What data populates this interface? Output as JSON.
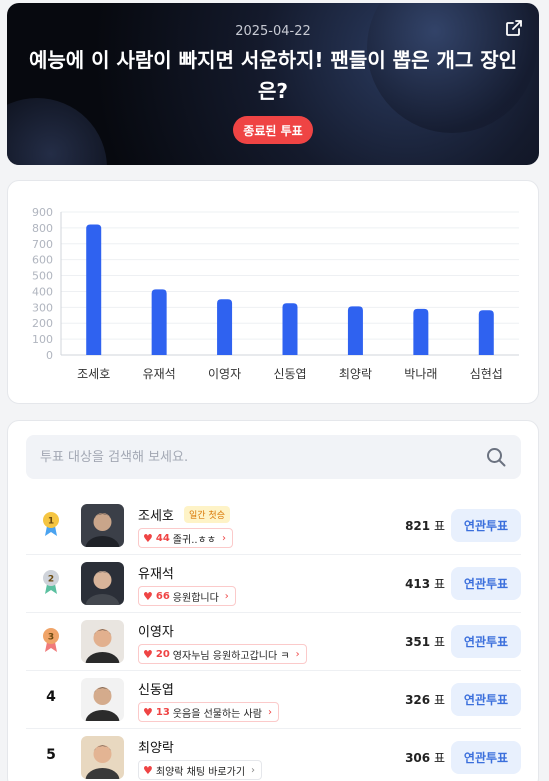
{
  "header": {
    "date": "2025-04-22",
    "title": "예능에 이 사람이 빠지면 서운하지! 팬들이 뽑은 개그 장인은?",
    "status_badge": "종료된 투표",
    "share_icon": "share-icon"
  },
  "chart_data": {
    "type": "bar",
    "categories": [
      "조세호",
      "유재석",
      "이영자",
      "신동엽",
      "최양락",
      "박나래",
      "심현섭"
    ],
    "values": [
      821,
      413,
      351,
      326,
      306,
      290,
      282
    ],
    "ylim": [
      0,
      900
    ],
    "yticks": [
      0,
      100,
      200,
      300,
      400,
      500,
      600,
      700,
      800,
      900
    ],
    "bar_color": "#2f62f0",
    "grid": true
  },
  "search": {
    "placeholder": "투표 대상을 검색해 보세요.",
    "icon": "search-icon"
  },
  "candidates": [
    {
      "rank": "1",
      "medal": "gold",
      "name": "조세호",
      "tag": "일간 첫승",
      "cheer_count": "44",
      "cheer_text": "졸귀..ㅎㅎ",
      "votes": "821",
      "unit": "표",
      "button": "연관투표"
    },
    {
      "rank": "2",
      "medal": "silver",
      "name": "유재석",
      "tag": "",
      "cheer_count": "66",
      "cheer_text": "응원합니다",
      "votes": "413",
      "unit": "표",
      "button": "연관투표"
    },
    {
      "rank": "3",
      "medal": "bronze",
      "name": "이영자",
      "tag": "",
      "cheer_count": "20",
      "cheer_text": "영자누님 응원하고갑니다 ㅋ",
      "votes": "351",
      "unit": "표",
      "button": "연관투표"
    },
    {
      "rank": "4",
      "medal": "",
      "name": "신동엽",
      "tag": "",
      "cheer_count": "13",
      "cheer_text": "웃음을 선물하는 사람",
      "votes": "326",
      "unit": "표",
      "button": "연관투표"
    },
    {
      "rank": "5",
      "medal": "",
      "name": "최양락",
      "tag": "",
      "cheer_count": "",
      "cheer_text": "최양락 채팅 바로가기",
      "votes": "306",
      "unit": "표",
      "button": "연관투표"
    }
  ]
}
